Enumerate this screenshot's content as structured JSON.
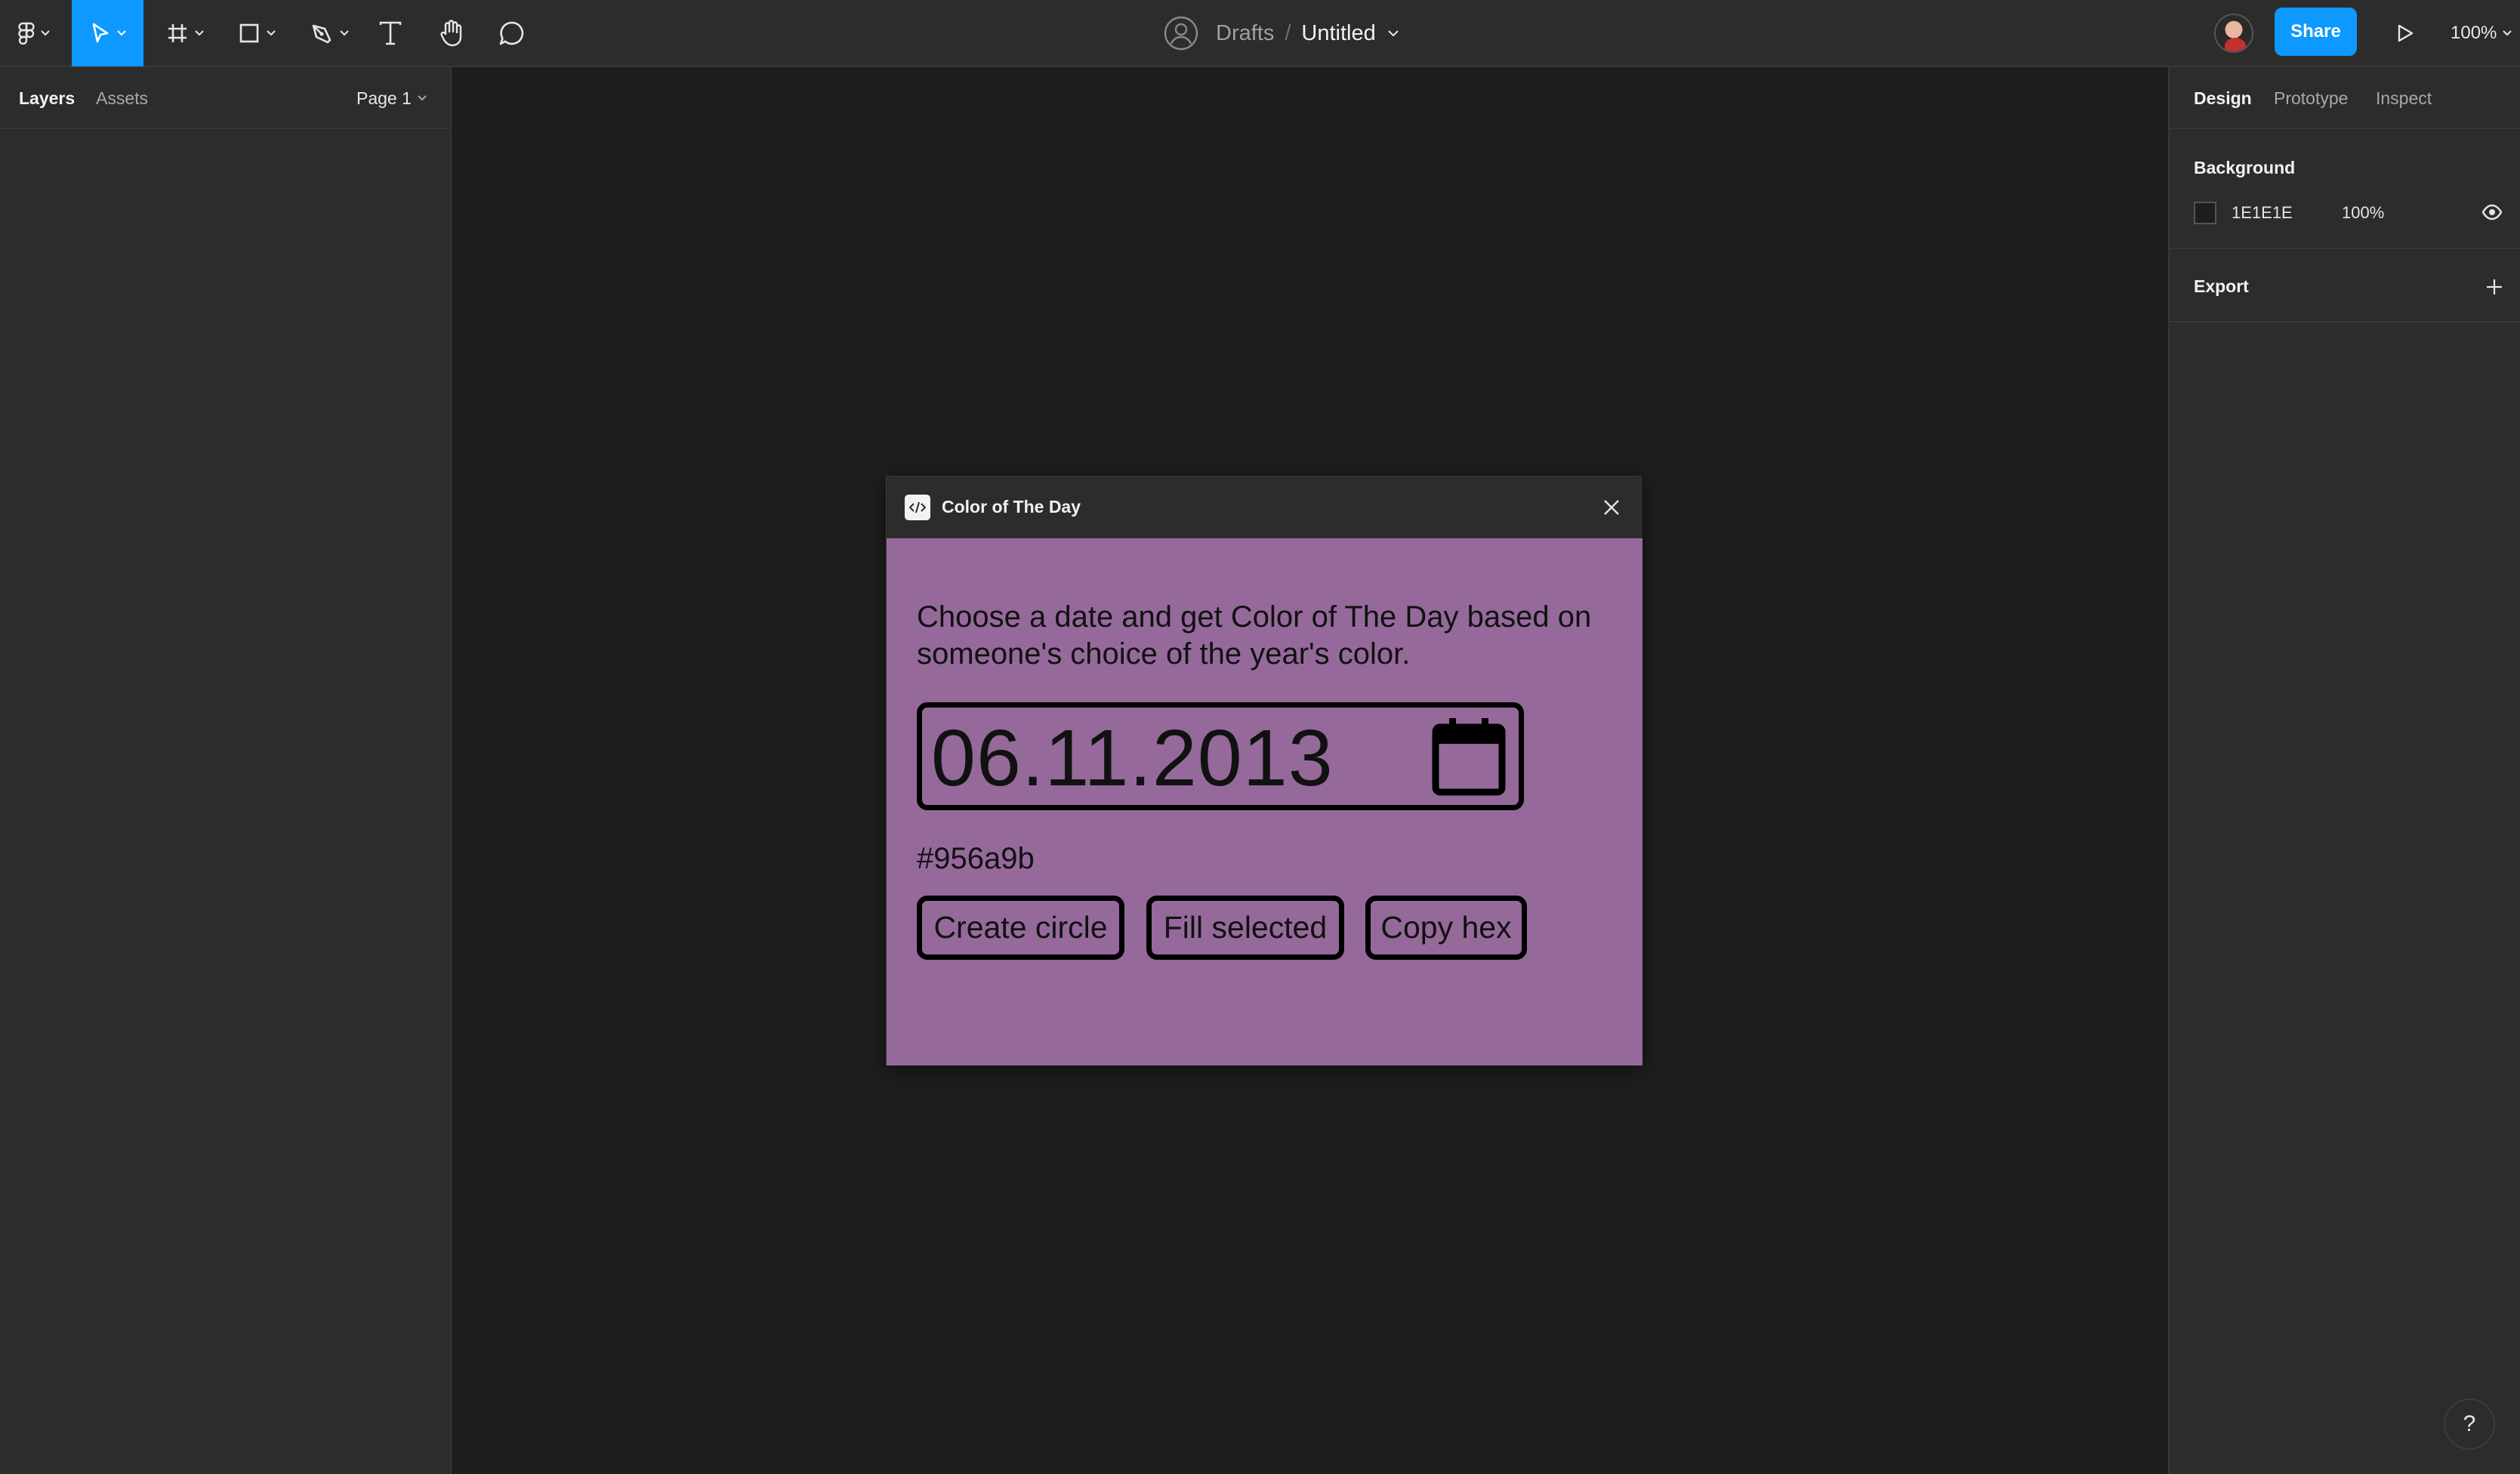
{
  "toolbar": {
    "file": {
      "location": "Drafts",
      "separator": "/",
      "name": "Untitled"
    },
    "share_label": "Share",
    "zoom_label": "100%",
    "active_color": "#0d99ff"
  },
  "left_panel": {
    "tabs": [
      {
        "label": "Layers",
        "active": true
      },
      {
        "label": "Assets",
        "active": false
      }
    ],
    "page_label": "Page 1"
  },
  "right_panel": {
    "tabs": [
      {
        "label": "Design",
        "active": true
      },
      {
        "label": "Prototype",
        "active": false
      },
      {
        "label": "Inspect",
        "active": false
      }
    ],
    "background": {
      "title": "Background",
      "hex": "1E1E1E",
      "opacity": "100%"
    },
    "export": {
      "title": "Export"
    }
  },
  "plugin": {
    "title": "Color of The Day",
    "description": "Choose a date and get Color of The Day based on someone's choice of the year's color.",
    "date_value": "06.11.2013",
    "hex_value": "#956a9b",
    "body_color": "#956a9b",
    "buttons": {
      "create_circle": "Create circle",
      "fill_selected": "Fill selected",
      "copy_hex": "Copy hex"
    }
  },
  "help_label": "?"
}
